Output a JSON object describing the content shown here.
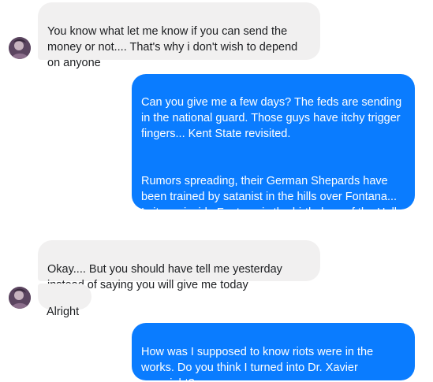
{
  "messages": [
    {
      "side": "incoming",
      "paragraphs": [
        "You know what let me know if you can send the money or not.... That's why i don't wish to depend on anyone"
      ]
    },
    {
      "side": "outgoing",
      "paragraphs": [
        "Can you give me a few days? The feds are sending in the national guard. Those guys have itchy trigger fingers... Kent State revisited.",
        "Rumors spreading, their German Shepards have been trained by satanist in the hills over Fontana... Is it a coincide Fontana is the birthplace of the Hells Angels? I submit, not."
      ]
    },
    {
      "side": "incoming",
      "paragraphs": [
        "Okay.... But you should have tell me yesterday instead of saying you will give me today"
      ]
    },
    {
      "side": "incoming",
      "paragraphs": [
        "Alright"
      ]
    },
    {
      "side": "outgoing",
      "paragraphs": [
        "How was I supposed to know riots were in the works. Do you think I turned into Dr. Xavier overnight?"
      ]
    }
  ],
  "colors": {
    "incoming_bubble": "#f1f0f0",
    "outgoing_bubble": "#0a7cff",
    "outgoing_text": "#ffffff",
    "incoming_text": "#1c1e21"
  },
  "icons": {
    "contact_avatar": "contact-avatar-photo"
  }
}
